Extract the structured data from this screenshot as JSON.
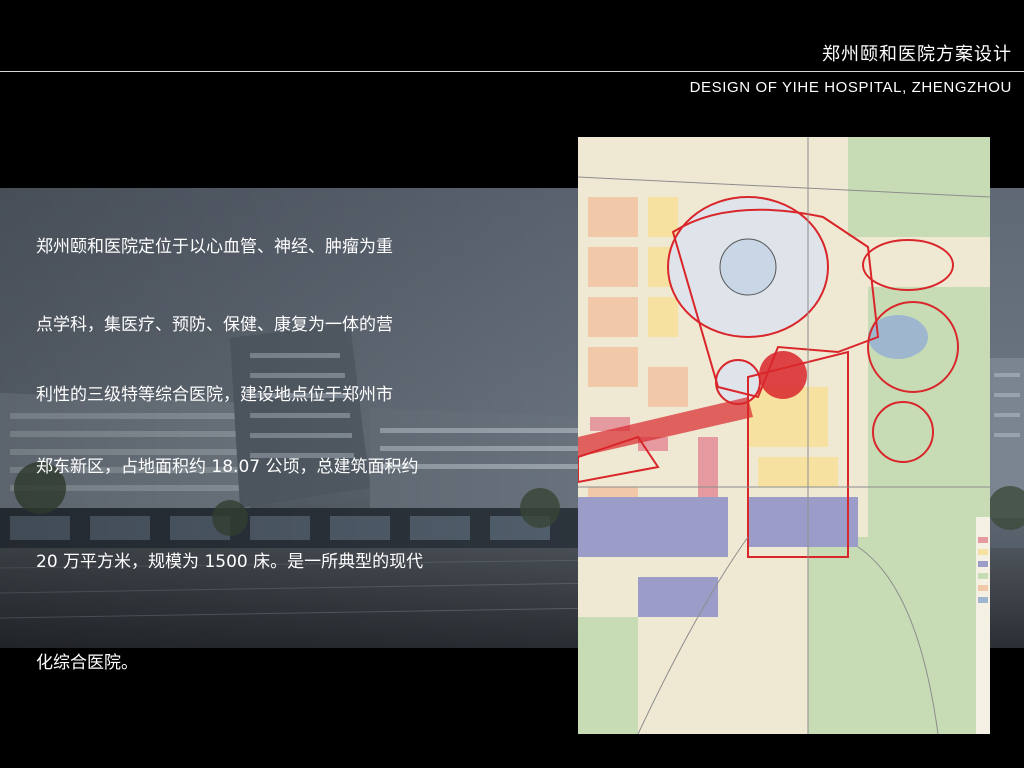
{
  "header": {
    "title_cn": "郑州颐和医院方案设计",
    "title_en": "DESIGN OF YIHE HOSPITAL, ZHENGZHOU"
  },
  "body": {
    "lines": [
      "郑州颐和医院定位于以心血管、神经、肿瘤为重",
      "点学科，集医疗、预防、保健、康复为一体的营",
      "利性的三级特等综合医院，建设地点位于郑州市",
      "郑东新区，占地面积约 18.07 公顷，总建筑面积约",
      "20 万平方米，规模为 1500 床。是一所典型的现代",
      "化综合医院。"
    ]
  },
  "images": {
    "background": "hospital-architectural-rendering",
    "map": "zhengdong-new-district-master-plan-map"
  },
  "colors": {
    "background": "#000000",
    "text": "#ffffff",
    "rule": "#d8d8d8",
    "map_red": "#d9262b"
  }
}
